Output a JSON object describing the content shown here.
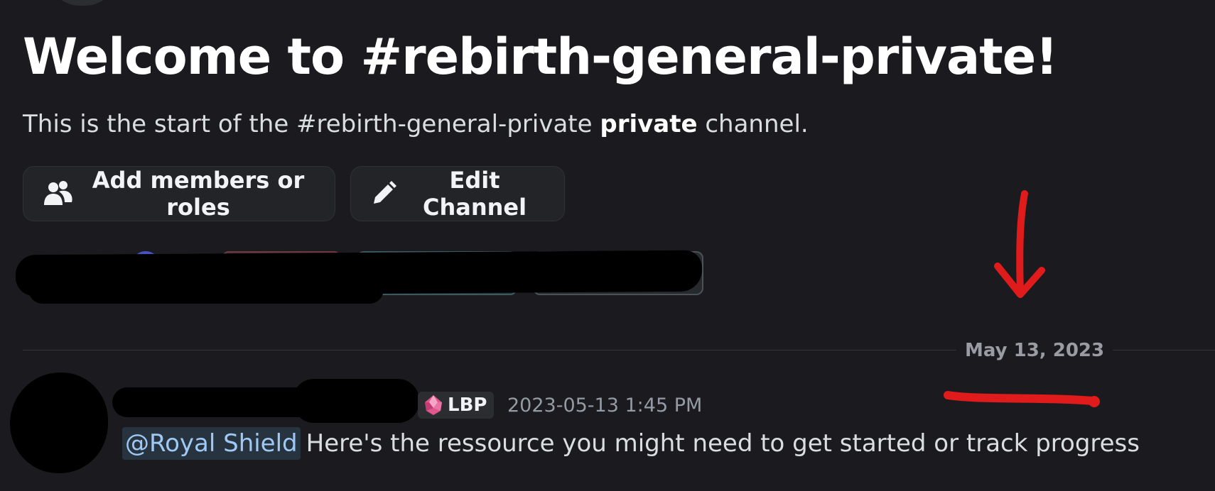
{
  "channel": {
    "welcome_title": "Welcome to #rebirth-general-private!",
    "subtitle_prefix": "This is the start of the #rebirth-general-private",
    "subtitle_bold": "private",
    "subtitle_suffix": "channel."
  },
  "actions": {
    "add_members_label": "Add members or roles",
    "edit_channel_label": "Edit Channel"
  },
  "divider": {
    "date": "May 13, 2023"
  },
  "message": {
    "role_tag": "LBP",
    "timestamp": "2023-05-13 1:45 PM",
    "mention": "@Royal Shield",
    "text": "Here's the ressource you might need to get started or track progress"
  },
  "icons": {
    "add_members": "people-icon",
    "edit_channel": "pencil-icon",
    "role_gem": "pink-gem-icon"
  },
  "colors": {
    "background": "#1b1b1f",
    "button_bg": "#232428",
    "mention_text": "#9fc9f5",
    "mention_bg": "#27343f",
    "annotation_red": "#e01b1b"
  }
}
